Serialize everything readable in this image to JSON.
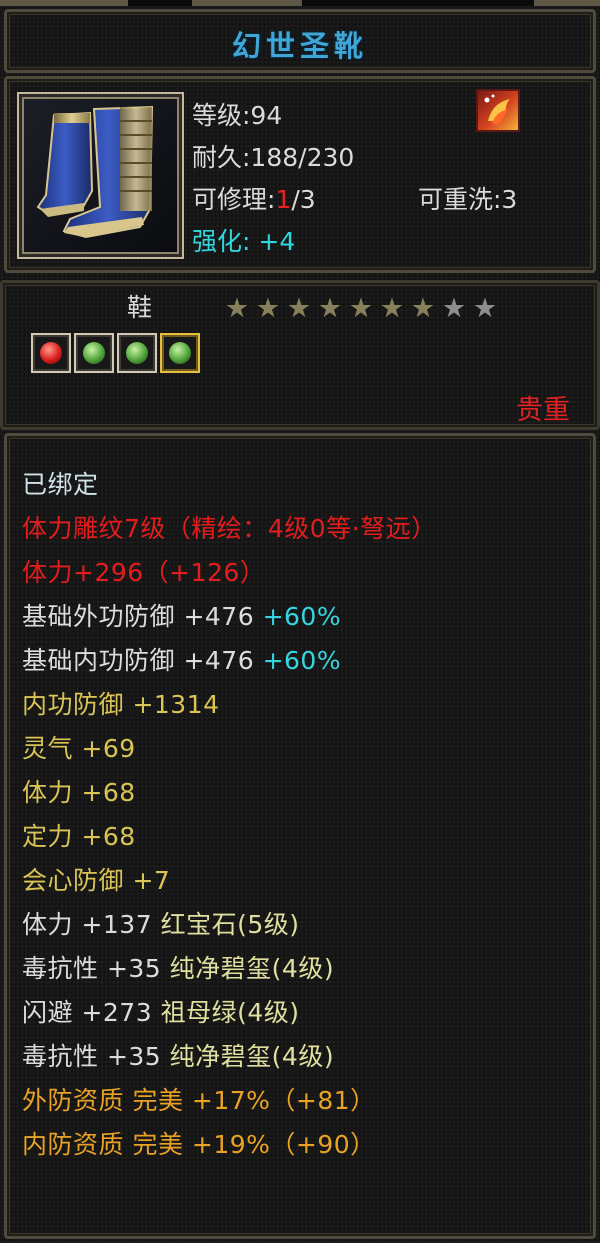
{
  "item": {
    "name": "幻世圣靴",
    "level_label": "等级:94",
    "durability_label": "耐久:188/230",
    "repair_prefix": "可修理:",
    "repair_current": "1",
    "repair_suffix": "/3",
    "reroll_label": "可重洗:3",
    "enhance_prefix": "强化:",
    "enhance_value": "+4",
    "type": "鞋",
    "stars": {
      "filled": 7,
      "total": 9
    },
    "gems": [
      "red",
      "green",
      "green",
      "green"
    ],
    "rarity": "贵重"
  },
  "attributes": {
    "bound": "已绑定",
    "carving": "体力雕纹7级（精绘：4级0等·弩远）",
    "stamina_main": "体力+296（+126）",
    "base_outer_def": {
      "text": "基础外功防御  +476 ",
      "pct": "+60%"
    },
    "base_inner_def": {
      "text": "基础内功防御  +476 ",
      "pct": "+60%"
    },
    "inner_def": "内功防御  +1314",
    "spirit": "灵气  +69",
    "stamina": "体力  +68",
    "focus": "定力  +68",
    "crit_def": "会心防御  +7",
    "gem_lines": [
      {
        "stat": "体力  +137  ",
        "gem": "红宝石(5级)"
      },
      {
        "stat": "毒抗性  +35  ",
        "gem": "纯净碧玺(4级)"
      },
      {
        "stat": "闪避  +273  ",
        "gem": "祖母绿(4级)"
      },
      {
        "stat": "毒抗性  +35  ",
        "gem": "纯净碧玺(4级)"
      }
    ],
    "outer_quality": "外防资质   完美  +17%（+81）",
    "inner_quality": "内防资质   完美  +19%（+90）"
  },
  "colors": {
    "title": "#3fa6d6",
    "red": "#e51c1c",
    "yellow": "#d9c455",
    "orange": "#eaa224",
    "cyan": "#35d6e0"
  }
}
